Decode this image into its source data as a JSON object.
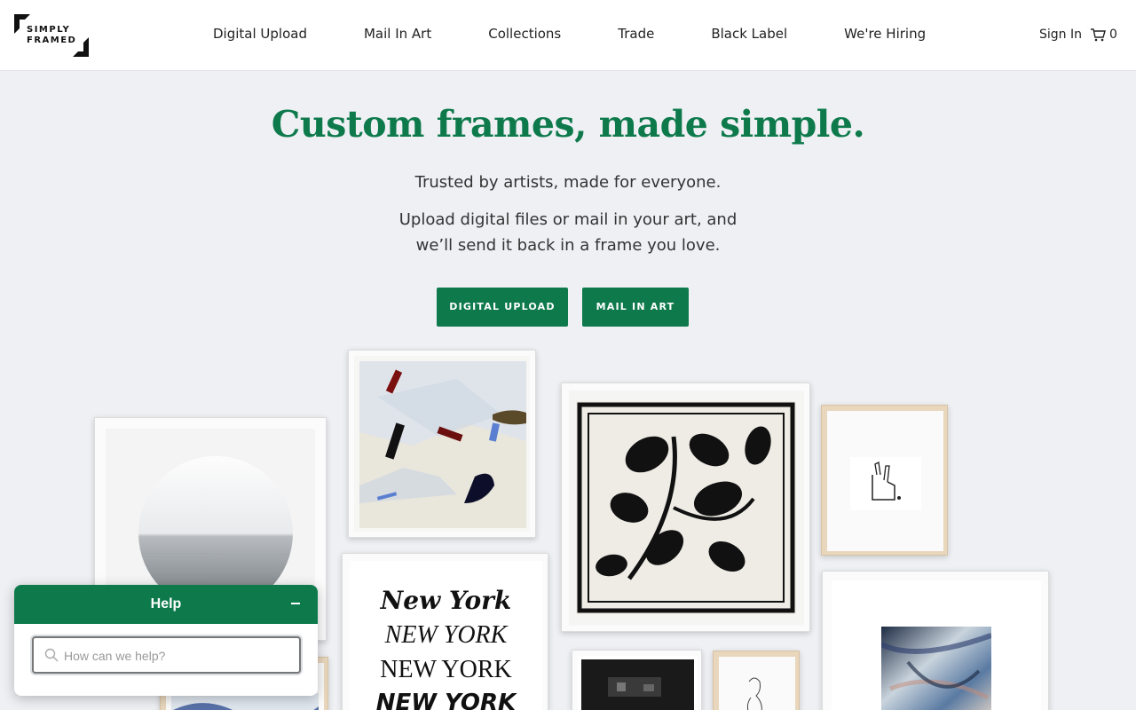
{
  "brand": {
    "logo_line1": "SIMPLY",
    "logo_line2": "FRAMED"
  },
  "nav": {
    "items": [
      {
        "label": "Digital Upload"
      },
      {
        "label": "Mail In Art"
      },
      {
        "label": "Collections"
      },
      {
        "label": "Trade"
      },
      {
        "label": "Black Label"
      },
      {
        "label": "We're Hiring"
      }
    ],
    "sign_in": "Sign In",
    "cart_count": "0"
  },
  "hero": {
    "title": "Custom frames, made simple.",
    "tagline": "Trusted by artists, made for everyone.",
    "description": "Upload digital files or mail in your art, and we’ll send it back in a frame you love.",
    "primary_button": "DIGITAL UPLOAD",
    "secondary_button": "MAIL IN ART"
  },
  "gallery": {
    "poster_lines": [
      "New York",
      "NEW YORK",
      "NEW YORK",
      "NEW YORK"
    ]
  },
  "chat": {
    "title": "Help",
    "search_placeholder": "How can we help?"
  },
  "colors": {
    "accent": "#0e7a4c",
    "background": "#eef0f4"
  },
  "icons": [
    "cart-icon",
    "search-icon",
    "minimize-icon"
  ]
}
